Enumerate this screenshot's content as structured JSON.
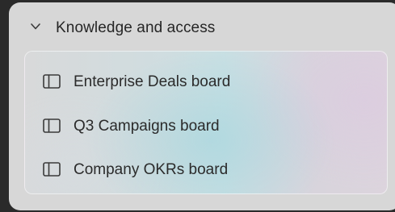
{
  "section": {
    "title": "Knowledge and access",
    "expanded": true,
    "chevron_icon": "chevron-down-icon"
  },
  "boards": [
    {
      "label": "Enterprise Deals board",
      "icon": "board-icon"
    },
    {
      "label": "Q3 Campaigns board",
      "icon": "board-icon"
    },
    {
      "label": "Company OKRs board",
      "icon": "board-icon"
    }
  ],
  "colors": {
    "panel_background": "#d7d7d7",
    "text": "#262626",
    "outer_background": "#2a2a2a"
  }
}
